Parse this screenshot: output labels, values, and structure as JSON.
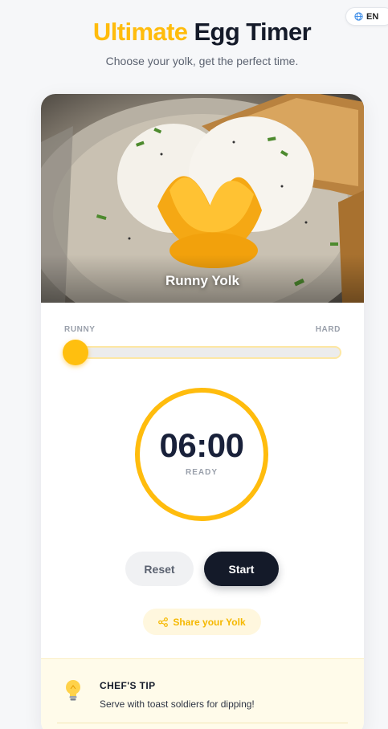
{
  "language": {
    "label": "EN",
    "icon": "globe-icon"
  },
  "header": {
    "title_accent": "Ultimate",
    "title_rest": "Egg Timer",
    "subtitle": "Choose your yolk, get the perfect time."
  },
  "hero": {
    "label": "Runny Yolk"
  },
  "slider": {
    "min_label": "RUNNY",
    "max_label": "HARD",
    "value_fraction": 0
  },
  "timer": {
    "time": "06:00",
    "status": "READY"
  },
  "buttons": {
    "reset": "Reset",
    "start": "Start"
  },
  "share": {
    "label": "Share your Yolk",
    "icon": "share-icon"
  },
  "tip": {
    "icon": "lightbulb-icon",
    "title": "CHEF'S TIP",
    "text": "Serve with toast soldiers for dipping!"
  },
  "colors": {
    "accent": "#ffbc0d",
    "dark": "#141a29",
    "background": "#f6f7f9"
  }
}
